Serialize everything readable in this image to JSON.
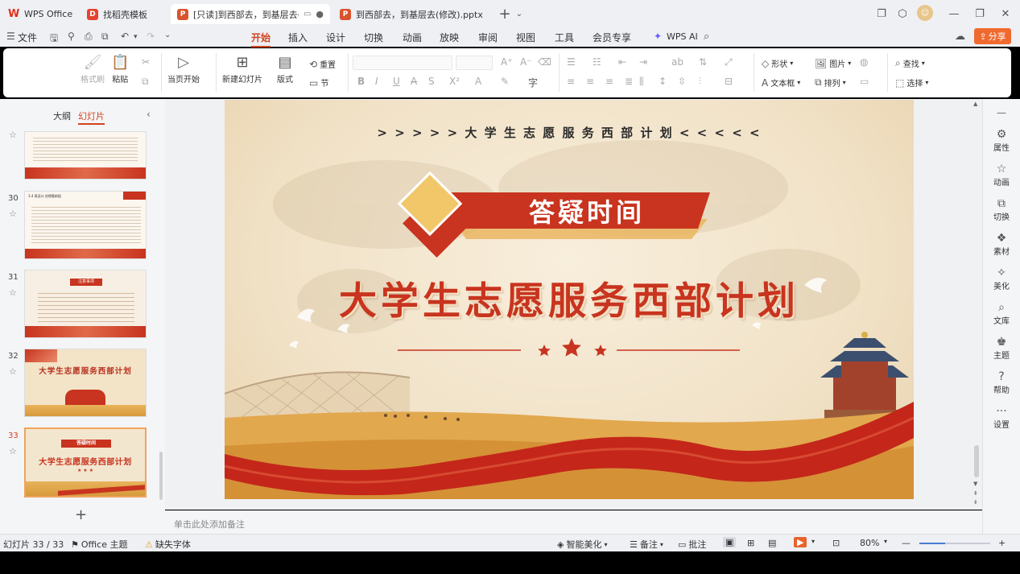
{
  "titlebar": {
    "tabs": [
      {
        "label": "WPS Office",
        "icon": "wps-logo-icon"
      },
      {
        "label": "找稻壳模板",
        "icon": "docer-icon"
      },
      {
        "label": "[只读]到西部去，到基层去(修改",
        "icon": "pptx-icon"
      },
      {
        "label": "到西部去，到基层去(修改).pptx",
        "icon": "pptx-icon"
      }
    ],
    "new_tab": "+"
  },
  "menubar": {
    "file_label": "文件",
    "items": [
      "开始",
      "插入",
      "设计",
      "切换",
      "动画",
      "放映",
      "审阅",
      "视图",
      "工具",
      "会员专享"
    ],
    "ai_label": "WPS AI",
    "share_label": "分享"
  },
  "ribbon": {
    "format_painter": "格式刷",
    "paste": "粘贴",
    "play_from_current": "当页开始",
    "new_slide": "新建幻灯片",
    "layout": "版式",
    "reset": "重置",
    "section": "节",
    "shape": "形状",
    "picture": "图片",
    "textbox": "文本框",
    "arrange": "排列",
    "find": "查找",
    "select": "选择"
  },
  "left_panel": {
    "tabs": [
      "大纲",
      "幻灯片"
    ],
    "active_tab": "幻灯片",
    "slides": [
      {
        "number": "",
        "title": ""
      },
      {
        "number": "30",
        "title": "3.4 再设计 创想看新报"
      },
      {
        "number": "31",
        "title": "注意事项"
      },
      {
        "number": "32",
        "title": "大学生志愿服务西部计划"
      },
      {
        "number": "33",
        "title": "大学生志愿服务西部计划",
        "banner": "答疑时间"
      }
    ],
    "add_slide": "+"
  },
  "slide": {
    "header_text": "> > > > > 大 学 生 志 愿 服 务 西 部 计 划 < < < < <",
    "banner": "答疑时间",
    "title": "大学生志愿服务西部计划",
    "colors": {
      "accent": "#c8341f",
      "gold": "#e9b35a",
      "background": "#f3e6cf"
    }
  },
  "notes": {
    "placeholder": "单击此处添加备注"
  },
  "right_panel": {
    "items": [
      {
        "label": "属性",
        "icon": "properties-icon"
      },
      {
        "label": "动画",
        "icon": "animation-icon"
      },
      {
        "label": "切换",
        "icon": "transition-icon"
      },
      {
        "label": "素材",
        "icon": "materials-icon"
      },
      {
        "label": "美化",
        "icon": "beautify-icon"
      },
      {
        "label": "文库",
        "icon": "library-icon"
      },
      {
        "label": "主题",
        "icon": "theme-icon"
      },
      {
        "label": "帮助",
        "icon": "help-icon"
      },
      {
        "label": "设置",
        "icon": "settings-icon"
      }
    ]
  },
  "statusbar": {
    "slide_counter": "幻灯片 33 / 33",
    "theme": "Office 主题",
    "missing_fonts": "缺失字体",
    "smart_beautify": "智能美化",
    "notes": "备注",
    "comments": "批注",
    "zoom": "80%",
    "zoom_level": 0.8
  }
}
